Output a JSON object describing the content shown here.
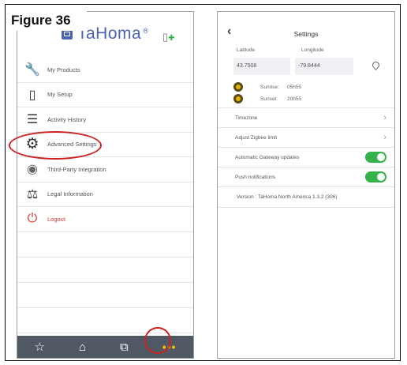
{
  "figure_label": "Figure 36",
  "left": {
    "brand_name": "TaHoma",
    "brand_mark": "®",
    "menu": [
      {
        "label": "My Products",
        "icon": "wrench-icon",
        "glyph": "🔧"
      },
      {
        "label": "My Setup",
        "icon": "device-icon",
        "glyph": "▯"
      },
      {
        "label": "Activity History",
        "icon": "list-icon",
        "glyph": "☰"
      },
      {
        "label": "Advanced Settings",
        "icon": "gear-icon",
        "glyph": "⚙"
      },
      {
        "label": "Third-Party Integration",
        "icon": "target-icon",
        "glyph": "◉"
      },
      {
        "label": "Legal Information",
        "icon": "scale-icon",
        "glyph": "⚖"
      },
      {
        "label": "Logout",
        "icon": "power-icon",
        "glyph": "⏻"
      }
    ],
    "bottom_nav": [
      {
        "icon": "star-icon",
        "glyph": "☆"
      },
      {
        "icon": "home-icon",
        "glyph": "⌂"
      },
      {
        "icon": "scenarios-icon",
        "glyph": "⧉"
      },
      {
        "icon": "more-icon",
        "glyph": "•••"
      }
    ]
  },
  "right": {
    "title": "Settings",
    "latitude_label": "Latitude",
    "longitude_label": "Longitude",
    "latitude": "43.7508",
    "longitude": "-79.8444",
    "sunrise_label": "Sunrise:",
    "sunrise": "05h55",
    "sunset_label": "Sunset:",
    "sunset": "20h55",
    "rows": {
      "timezone": "Timezone",
      "zigbee": "Adjust Zigbee limit",
      "gateway_updates": "Automatic Gateway updates",
      "push": "Push notifications"
    },
    "toggles": {
      "gateway_updates": true,
      "push": true
    },
    "version": "Version : TaHoma North America 1.3.2 (306)"
  },
  "colors": {
    "accent": "#4a62b3",
    "toggle_on": "#35b34a",
    "logout": "#d7352f",
    "highlight": "#cc2222",
    "nav_bg": "#505863"
  }
}
